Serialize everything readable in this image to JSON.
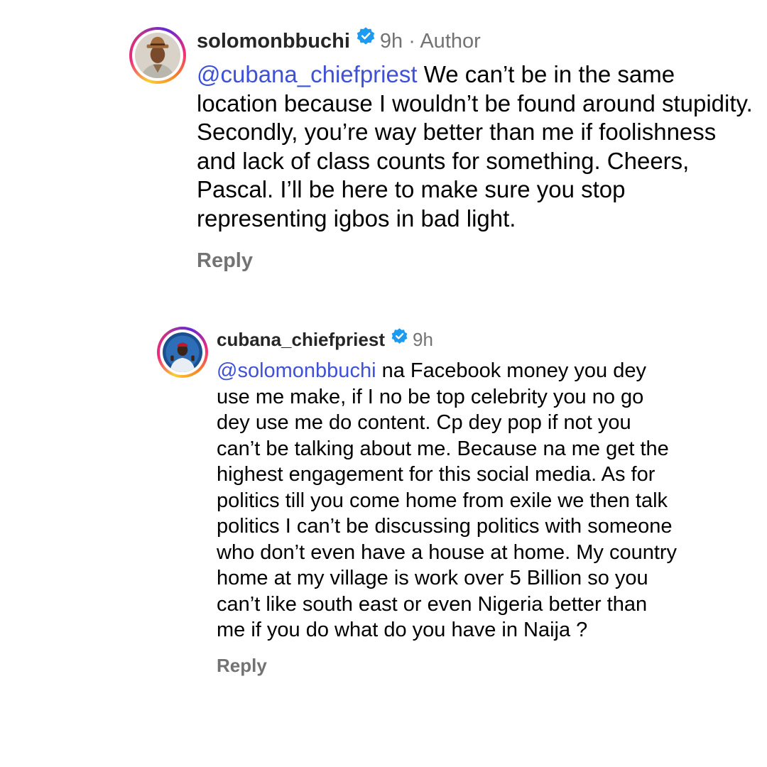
{
  "colors": {
    "mention": "#3f51d6",
    "verified_badge": "#1d9bf0",
    "meta": "#737373",
    "username": "#262626"
  },
  "comments": [
    {
      "username": "solomonbbuchi",
      "verified": true,
      "verified_icon": "verified-badge-icon",
      "time": "9h",
      "separator": "·",
      "author_label": "Author",
      "mention": "@cubana_chiefpriest",
      "text": " We can’t be in the same location because I wouldn’t be found around stupidity. Secondly, you’re way better than me if foolishness and lack of class counts for something. Cheers, Pascal. I’ll be here to make sure you stop representing igbos in bad light.",
      "reply_label": "Reply"
    },
    {
      "username": "cubana_chiefpriest",
      "verified": true,
      "verified_icon": "verified-badge-icon",
      "time": "9h",
      "mention": "@solomonbbuchi",
      "text": " na Facebook money you dey use me make, if I no be top celebrity you no go dey use me do content. Cp dey pop if not you can’t be talking about me. Because na me get the highest engagement for this social media. As for politics till you come home from exile we then talk politics I can’t be discussing politics with someone who don’t even have a house at home. My country home at my village is work over 5 Billion so you can’t like south east or even Nigeria better than me if you do what do you have in Naija ?",
      "reply_label": "Reply"
    }
  ]
}
